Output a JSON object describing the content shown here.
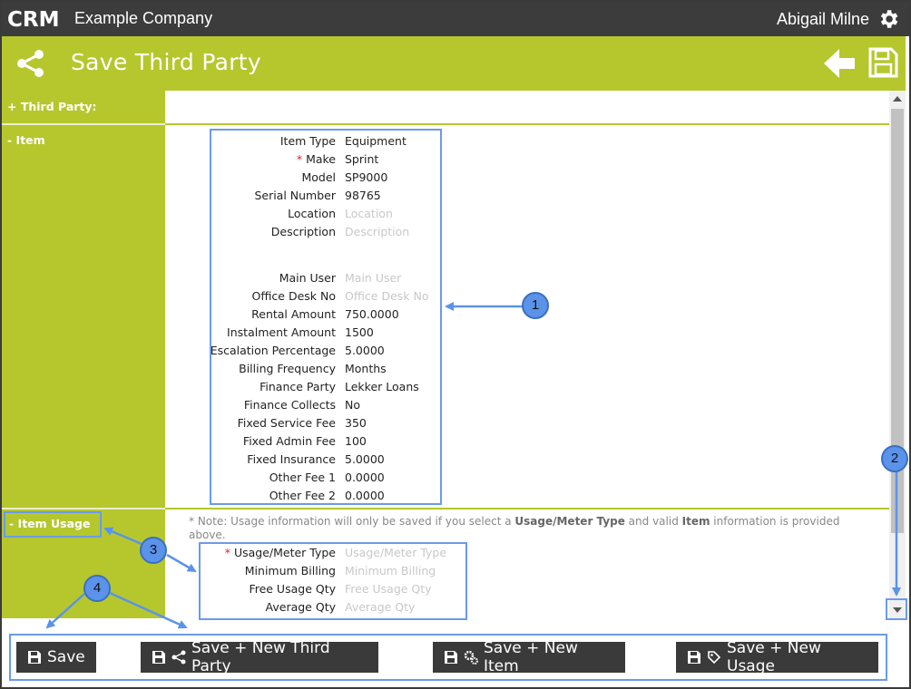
{
  "app": {
    "brand": "CRM",
    "company": "Example Company",
    "user": "Abigail Milne"
  },
  "header": {
    "title": "Save Third Party"
  },
  "sections": {
    "third_party": "+ Third Party:",
    "item": "- Item",
    "item_usage": "- Item Usage"
  },
  "item_fields": [
    {
      "label": "Item Type",
      "value": "Equipment",
      "placeholder": false,
      "required": false
    },
    {
      "label": "Make",
      "value": "Sprint",
      "placeholder": false,
      "required": true
    },
    {
      "label": "Model",
      "value": "SP9000",
      "placeholder": false,
      "required": false
    },
    {
      "label": "Serial Number",
      "value": "98765",
      "placeholder": false,
      "required": false
    },
    {
      "label": "Location",
      "value": "Location",
      "placeholder": true,
      "required": false
    },
    {
      "label": "Description",
      "value": "Description",
      "placeholder": true,
      "required": false
    },
    {
      "label": "Main User",
      "value": "Main User",
      "placeholder": true,
      "required": false
    },
    {
      "label": "Office Desk No",
      "value": "Office Desk No",
      "placeholder": true,
      "required": false
    },
    {
      "label": "Rental Amount",
      "value": "750.0000",
      "placeholder": false,
      "required": false
    },
    {
      "label": "Instalment Amount",
      "value": "1500",
      "placeholder": false,
      "required": false
    },
    {
      "label": "Escalation Percentage",
      "value": "5.0000",
      "placeholder": false,
      "required": false
    },
    {
      "label": "Billing Frequency",
      "value": "Months",
      "placeholder": false,
      "required": false
    },
    {
      "label": "Finance Party",
      "value": "Lekker Loans",
      "placeholder": false,
      "required": false
    },
    {
      "label": "Finance Collects",
      "value": "No",
      "placeholder": false,
      "required": false
    },
    {
      "label": "Fixed Service Fee",
      "value": "350",
      "placeholder": false,
      "required": false
    },
    {
      "label": "Fixed Admin Fee",
      "value": "100",
      "placeholder": false,
      "required": false
    },
    {
      "label": "Fixed Insurance",
      "value": "5.0000",
      "placeholder": false,
      "required": false
    },
    {
      "label": "Other Fee 1",
      "value": "0.0000",
      "placeholder": false,
      "required": false
    },
    {
      "label": "Other Fee 2",
      "value": "0.0000",
      "placeholder": false,
      "required": false
    }
  ],
  "usage_note": {
    "prefix": "* Note: Usage information will only be saved if you select a ",
    "bold1": "Usage/Meter Type",
    "middle": " and valid ",
    "bold2": "Item",
    "suffix": " information is provided above."
  },
  "usage_fields": [
    {
      "label": "Usage/Meter Type",
      "value": "Usage/Meter Type",
      "placeholder": true,
      "required": true
    },
    {
      "label": "Minimum Billing",
      "value": "Minimum Billing",
      "placeholder": true,
      "required": false
    },
    {
      "label": "Free Usage Qty",
      "value": "Free Usage Qty",
      "placeholder": true,
      "required": false
    },
    {
      "label": "Average Qty",
      "value": "Average Qty",
      "placeholder": true,
      "required": false
    }
  ],
  "buttons": {
    "save": "Save",
    "save_new_third_party": "Save + New Third Party",
    "save_new_item": "Save + New Item",
    "save_new_usage": "Save + New Usage"
  },
  "callouts": [
    "1",
    "2",
    "3",
    "4"
  ],
  "colors": {
    "topbar": "#3c3c3c",
    "accent": "#b5c72d",
    "annotation": "#6a9be8",
    "button": "#3a3a3a"
  }
}
